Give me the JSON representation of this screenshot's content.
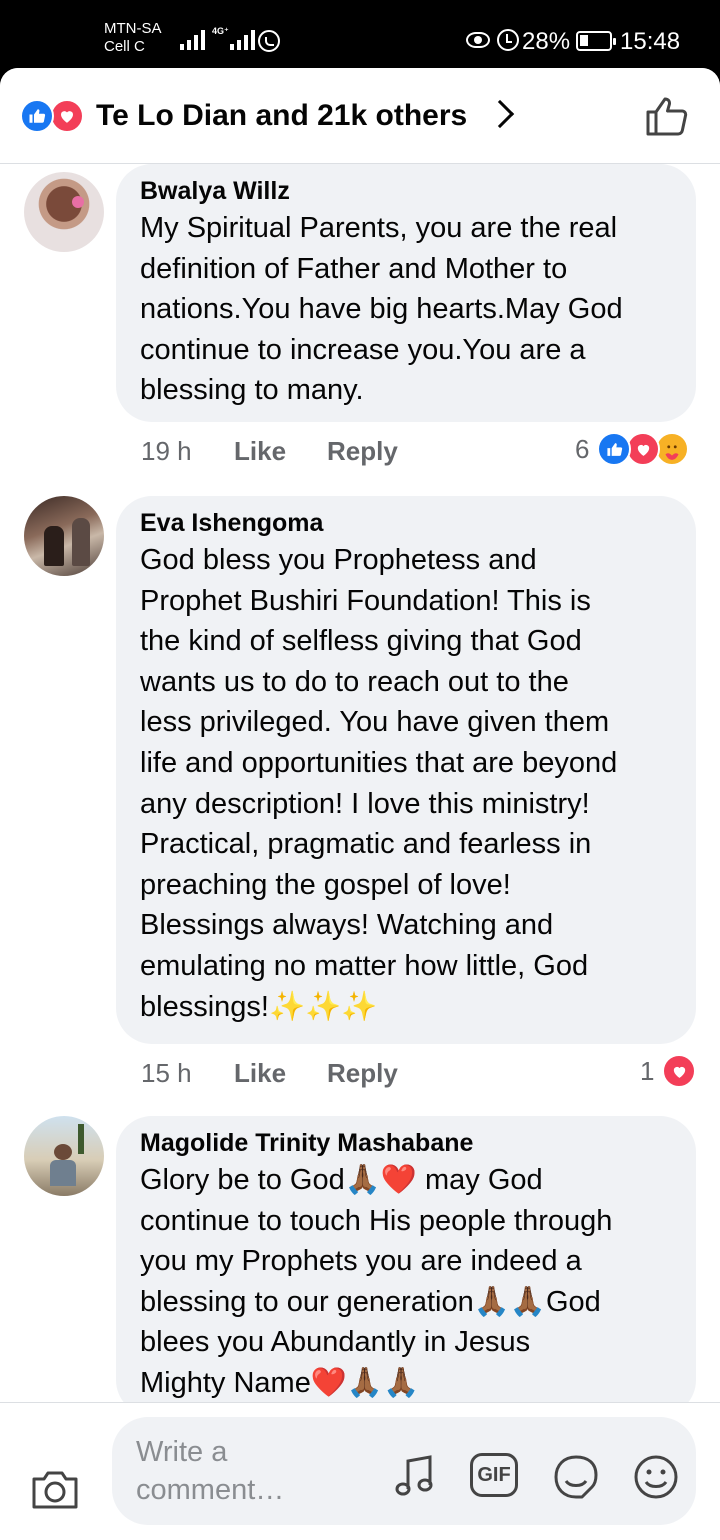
{
  "status_bar": {
    "carrier_primary": "MTN-SA",
    "carrier_secondary": "Cell C",
    "network_type": "4G⁺",
    "battery": "28%",
    "time": "15:48",
    "icons": [
      "signal-icon",
      "whatsapp-icon",
      "eye-icon",
      "alarm-icon",
      "battery-icon"
    ]
  },
  "reactions_header": {
    "summary": "Te Lo Dian and 21k others",
    "reaction_types": [
      "like",
      "love"
    ]
  },
  "comments": [
    {
      "author": "Bwalya Willz",
      "text": "My Spiritual Parents, you are the real\ndefinition of Father and Mother to\nnations.You have big hearts.May God\ncontinue to increase you.You are a\nblessing to many.",
      "time": "19 h",
      "like_label": "Like",
      "reply_label": "Reply",
      "reaction_count": "6",
      "reaction_types": [
        "like",
        "love",
        "care"
      ]
    },
    {
      "author": "Eva Ishengoma",
      "text": "God bless you Prophetess and\nProphet Bushiri Foundation! This is\nthe kind of selfless giving that God\nwants us to do to reach out to the\nless privileged. You have given them\nlife and opportunities that are beyond\nany description! I love this ministry!\nPractical, pragmatic and fearless in\npreaching the gospel of love!\nBlessings always! Watching and\nemulating no matter how little, God\nblessings!✨✨✨",
      "time": "15 h",
      "like_label": "Like",
      "reply_label": "Reply",
      "reaction_count": "1",
      "reaction_types": [
        "love"
      ]
    },
    {
      "author": "Magolide Trinity Mashabane",
      "text": "Glory be to God🙏🏾❤️ may God\ncontinue to touch His people through\nyou my Prophets you are indeed a\nblessing to our generation🙏🏾🙏🏾God\nblees you Abundantly in Jesus\nMighty Name❤️🙏🏾🙏🏾"
    }
  ],
  "composer": {
    "placeholder": "Write a comment…",
    "gif_label": "GIF",
    "icons": [
      "camera-icon",
      "music-icon",
      "gif-icon",
      "sticker-icon",
      "emoji-icon"
    ]
  },
  "colors": {
    "like_blue": "#1877f2",
    "love_red": "#f33e58",
    "bubble_gray": "#f0f2f5",
    "secondary_text": "#65676b"
  }
}
